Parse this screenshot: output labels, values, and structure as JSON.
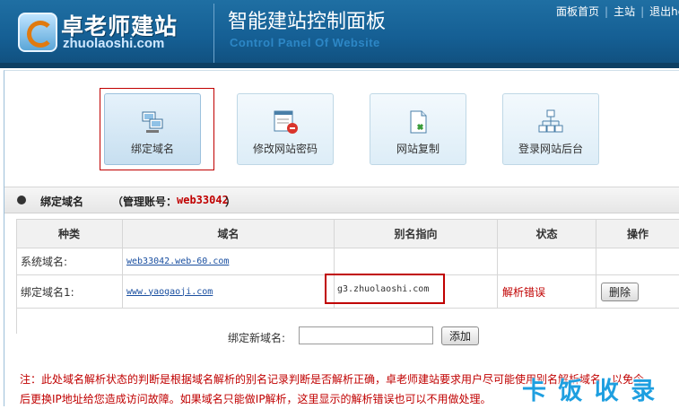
{
  "header": {
    "logo_cn": "卓老师建站",
    "logo_en": "zhuolaoshi.com",
    "title": "智能建站控制面板",
    "subtitle": "Control Panel Of Website",
    "links": [
      "面板首页",
      "主站",
      "退出here"
    ]
  },
  "tiles": [
    {
      "label": "绑定域名",
      "icon": "network-icon"
    },
    {
      "label": "修改网站密码",
      "icon": "password-form-icon"
    },
    {
      "label": "网站复制",
      "icon": "copy-document-icon"
    },
    {
      "label": "登录网站后台",
      "icon": "sitemap-icon"
    }
  ],
  "section": {
    "title": "绑定域名",
    "account_label": "（管理账号：",
    "account_value": "web33042",
    "account_close": "）"
  },
  "table": {
    "headers": [
      "种类",
      "域名",
      "别名指向",
      "状态",
      "操作"
    ],
    "rows": [
      {
        "type": "系统域名:",
        "domain": "web33042.web-60.com",
        "alias": "",
        "status": "",
        "action": ""
      },
      {
        "type": "绑定域名1:",
        "domain": "www.yaogaoji.com",
        "alias": "g3.zhuolaoshi.com",
        "status": "解析错误",
        "action": "删除"
      }
    ]
  },
  "add": {
    "label": "绑定新域名:",
    "input_value": "",
    "button": "添加"
  },
  "note": {
    "line1": "注：此处域名解析状态的判断是根据域名解析的别名记录判断是否解析正确，卓老师建站要求用户尽可能使用别名解析域名，以免今",
    "line2": "后更换IP地址给您造成访问故障。如果域名只能做IP解析，这里显示的解析错误也可以不用做处理。"
  },
  "watermark": "卡 饭 收 录",
  "colors": {
    "header_blue": "#155f94",
    "error_red": "#c00000",
    "link_blue": "#1a4fa0"
  }
}
